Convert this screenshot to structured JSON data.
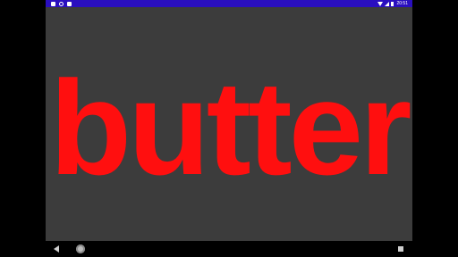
{
  "status_bar": {
    "time": "20:51",
    "left_icons": [
      "notification-icon",
      "settings-icon",
      "lock-icon"
    ],
    "right_icons": [
      "wifi-icon",
      "signal-icon",
      "battery-icon"
    ],
    "color": "#2a0fbf"
  },
  "main": {
    "word": "butter",
    "text_color": "#ff0f0f",
    "background": "#3c3c3c"
  },
  "nav_bar": {
    "buttons": [
      "back",
      "home",
      "recents"
    ]
  }
}
